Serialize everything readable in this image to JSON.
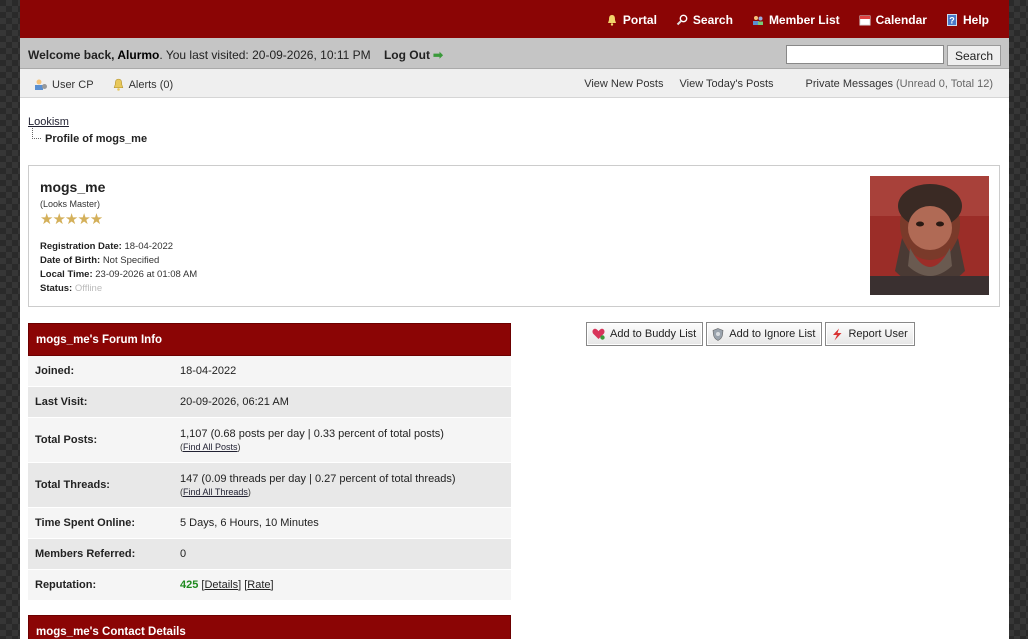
{
  "nav": {
    "items": [
      {
        "label": "Portal",
        "icon": "portal-icon"
      },
      {
        "label": "Search",
        "icon": "search-icon"
      },
      {
        "label": "Member List",
        "icon": "member-list-icon"
      },
      {
        "label": "Calendar",
        "icon": "calendar-icon"
      },
      {
        "label": "Help",
        "icon": "help-icon"
      }
    ]
  },
  "welcome": {
    "prefix": "Welcome back, ",
    "username": "Alurmo",
    "last_visit": ". You last visited: 20-09-2026, 10:11 PM",
    "logout": "Log Out",
    "search_button": "Search",
    "search_value": ""
  },
  "userbar": {
    "user_cp": "User CP",
    "alerts": "Alerts (0)",
    "new_posts": "View New Posts",
    "todays_posts": "View Today's Posts",
    "pm": "Private Messages",
    "pm_counts": "(Unread 0, Total 12)"
  },
  "breadcrumb": {
    "home": "Lookism",
    "current": "Profile of mogs_me"
  },
  "profile": {
    "username": "mogs_me",
    "title": "(Looks Master)",
    "stars": 5,
    "star_glyphs": "★★★★★",
    "reg_label": "Registration Date:",
    "reg_value": "18-04-2022",
    "dob_label": "Date of Birth:",
    "dob_value": "Not Specified",
    "local_label": "Local Time:",
    "local_value": "23-09-2026 at 01:08 AM",
    "status_label": "Status:",
    "status_value": "Offline"
  },
  "forum_info": {
    "heading": "mogs_me's Forum Info",
    "rows": [
      {
        "label": "Joined:",
        "value": "18-04-2022"
      },
      {
        "label": "Last Visit:",
        "value": "20-09-2026, 06:21 AM"
      },
      {
        "label": "Total Posts:",
        "value": "1,107 (0.68 posts per day | 0.33 percent of total posts)",
        "sub": "Find All Posts"
      },
      {
        "label": "Total Threads:",
        "value": "147 (0.09 threads per day | 0.27 percent of total threads)",
        "sub": "Find All Threads"
      },
      {
        "label": "Time Spent Online:",
        "value": "5 Days, 6 Hours, 10 Minutes"
      },
      {
        "label": "Members Referred:",
        "value": "0"
      },
      {
        "label": "Reputation:",
        "rep": "425",
        "details": "Details",
        "rate": "Rate"
      }
    ]
  },
  "actions": {
    "buddy": "Add to Buddy List",
    "ignore": "Add to Ignore List",
    "report": "Report User"
  },
  "contact": {
    "heading": "mogs_me's Contact Details"
  },
  "colors": {
    "header": "#8b0505",
    "reputation": "#1f8a1f"
  }
}
